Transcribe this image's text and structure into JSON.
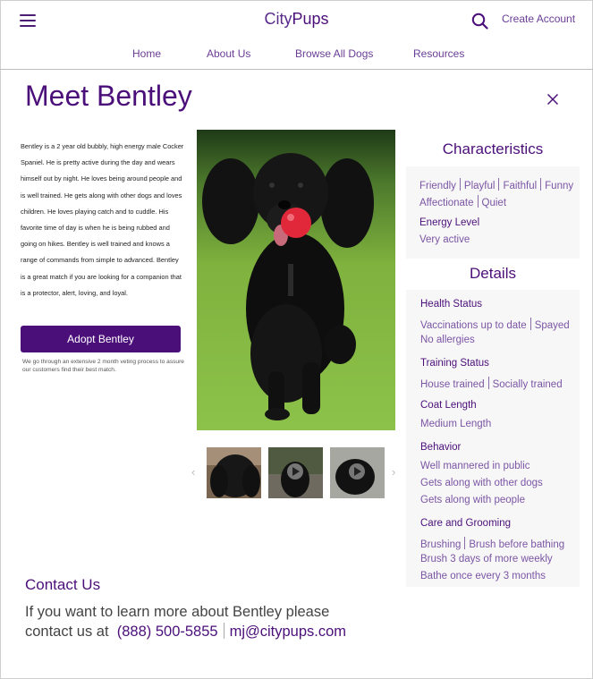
{
  "header": {
    "logo_city": "City",
    "logo_pups": "Pups",
    "create_account": "Create Account",
    "nav": [
      "Home",
      "About Us",
      "Browse All Dogs",
      "Resources"
    ]
  },
  "page_title": "Meet Bentley",
  "description": "Bentley is a 2 year old bubbly, high energy male Cocker Spaniel. He is pretty active during the day and wears himself out by night. He loves being around people and is well trained. He gets along with other dogs and loves children. He loves playing catch and to cuddle. His favorite time of day is when he is being rubbed and going on hikes. Bentley is well trained and knows a range of commands from simple to advanced. Bentley is a great match if you are looking for a companion that is a protector, alert, loving, and loyal.",
  "adopt_button": "Adopt Bentley",
  "adopt_note": "We go through an extensive 2 month veting process to assure our customers find their best match.",
  "characteristics": {
    "title": "Characteristics",
    "traits_line1": [
      "Friendly",
      "Playful",
      "Faithful",
      "Funny"
    ],
    "traits_line2": [
      "Affectionate",
      "Quiet"
    ],
    "energy_label": "Energy Level",
    "energy_value": "Very active"
  },
  "details": {
    "title": "Details",
    "health_label": "Health Status",
    "health_line1": [
      "Vaccinations up to date",
      "Spayed"
    ],
    "health_line2": "No allergies",
    "training_label": "Training Status",
    "training_line1": [
      "House trained",
      "Socially trained"
    ],
    "coat_label": "Coat Length",
    "coat_value": "Medium Length",
    "behavior_label": "Behavior",
    "behavior_lines": [
      "Well mannered in public",
      "Gets along with other dogs",
      "Gets along with people"
    ],
    "care_label": "Care and Grooming",
    "care_line1": [
      "Brushing",
      "Brush before bathing"
    ],
    "care_line2": "Brush 3 days of more weekly",
    "care_line3": "Bathe once every 3 months"
  },
  "contact": {
    "title": "Contact Us",
    "text_line1": "If you want to learn more about Bentley please",
    "text_line2": "contact us at",
    "phone": "(888) 500-5855",
    "email": "mj@citypups.com"
  },
  "colors": {
    "brand": "#4b0f7a",
    "link": "#7b55a4",
    "panel_bg": "#f7f7f7"
  },
  "icons": [
    "menu-icon",
    "search-icon",
    "close-icon",
    "play-icon",
    "chevron-left-icon",
    "chevron-right-icon"
  ]
}
